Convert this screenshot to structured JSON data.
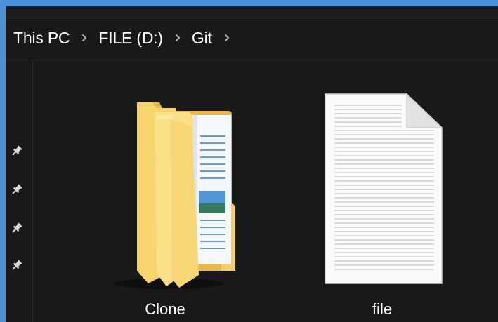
{
  "breadcrumb": {
    "items": [
      {
        "label": "This PC"
      },
      {
        "label": "FILE (D:)"
      },
      {
        "label": "Git"
      }
    ],
    "separator_icon": "chevron-right-icon"
  },
  "nav_pane": {
    "pins": [
      "pin-icon",
      "pin-icon",
      "pin-icon",
      "pin-icon"
    ]
  },
  "files": [
    {
      "name": "Clone",
      "type": "folder",
      "icon": "folder-icon"
    },
    {
      "name": "file",
      "type": "document",
      "icon": "text-document-icon"
    }
  ],
  "colors": {
    "window_bg": "#191919",
    "outer_border": "#4a90d9",
    "text": "#ffffff",
    "folder": "#f7d774"
  }
}
